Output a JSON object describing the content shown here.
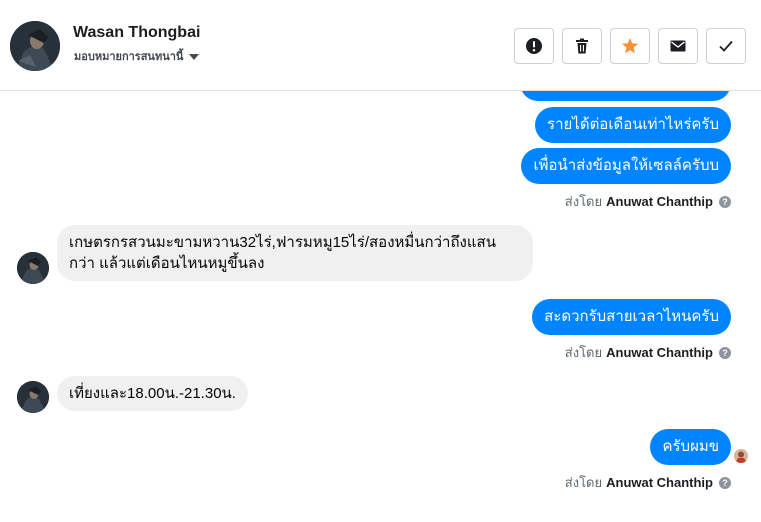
{
  "header": {
    "contact_name": "Wasan Thongbai",
    "assign_label": "มอบหมายการสนทนานี้",
    "actions": [
      {
        "name": "report-button",
        "icon": "exclamation-icon"
      },
      {
        "name": "delete-button",
        "icon": "trash-icon"
      },
      {
        "name": "star-button",
        "icon": "star-icon",
        "color": "#f7923a"
      },
      {
        "name": "mark-unread-button",
        "icon": "envelope-icon"
      },
      {
        "name": "mark-done-button",
        "icon": "checkmark-icon"
      }
    ]
  },
  "sent_by": {
    "prefix": "ส่งโดย",
    "name": "Anuwat Chanthip",
    "help": "?"
  },
  "messages": [
    {
      "direction": "out",
      "text": "รายได้ต่อเดือนเท่าไหร่ครับ"
    },
    {
      "direction": "out",
      "text": "เพื่อนำส่งข้อมูลให้เซลล์ครับบ"
    },
    {
      "direction": "in",
      "text": "เกษตรกรสวนมะขามหวาน32ไร่,ฟารมหมู15ไร่/สองหมื่นกว่าถึงแสนกว่า แล้วแต่เดือนไหนหมูขึ้นลง"
    },
    {
      "direction": "out",
      "text": "สะดวกรับสายเวลาไหนครับ"
    },
    {
      "direction": "in",
      "text": "เที่ยงและ18.00น.-21.30น."
    },
    {
      "direction": "out",
      "text": "ครับผมข"
    }
  ],
  "colors": {
    "outgoing_bubble": "#0084ff",
    "incoming_bubble": "#f0f0f0",
    "star": "#f7923a"
  }
}
